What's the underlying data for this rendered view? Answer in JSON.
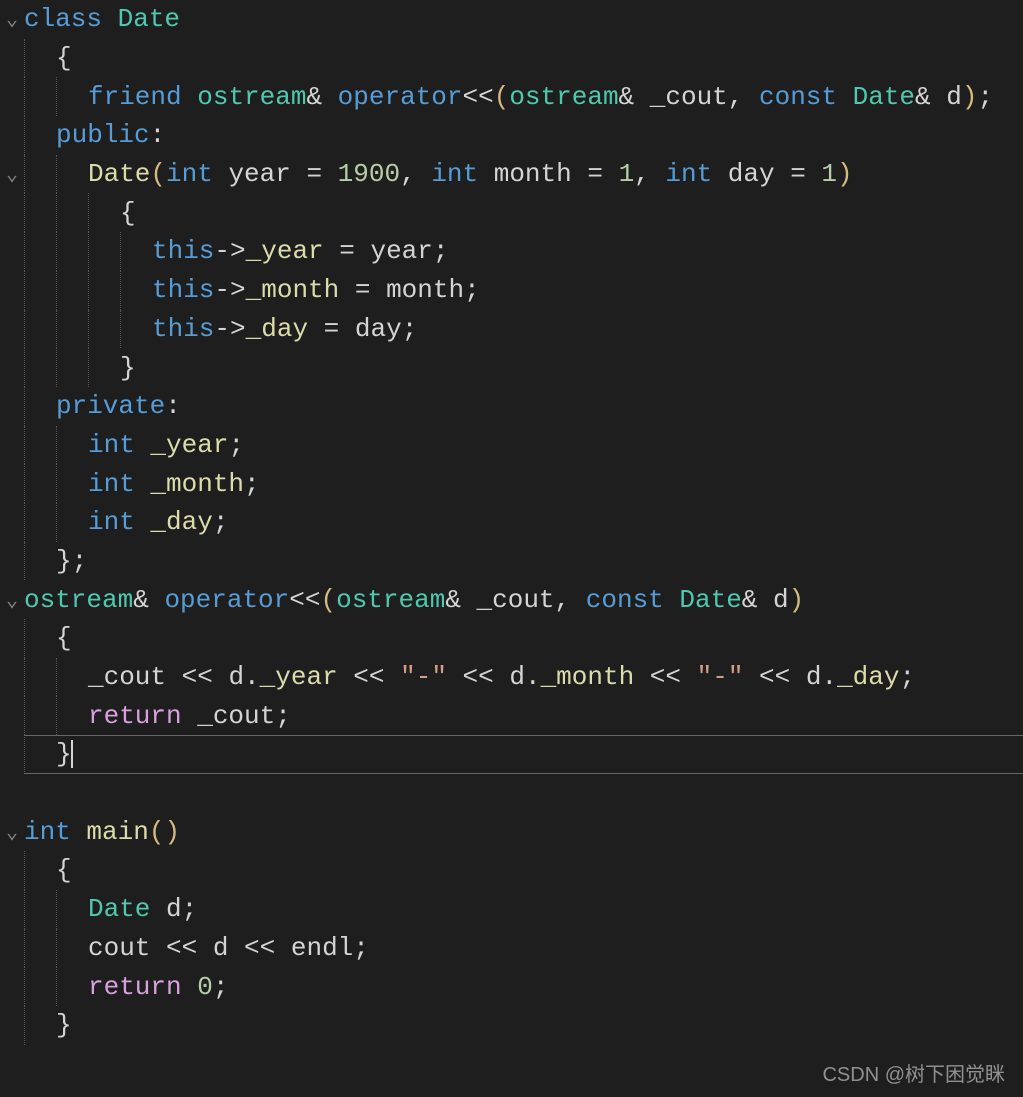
{
  "class_kw": "class",
  "class_name": "Date",
  "obrace": "{",
  "cbrace": "}",
  "cbrace_semi": "};",
  "friend_kw": "friend",
  "ostream_amp": "ostream&",
  "operator_kw": "operator",
  "shl": "<<",
  "oparen": "(",
  "cparen": ")",
  "ostream_word": "ostream",
  "amp": "&",
  "cout_param": " _cout",
  "comma_sp": ", ",
  "const_kw": "const",
  "date_type": " Date",
  "d_param": " d",
  "semi": ";",
  "public_kw": "public",
  "colon": ":",
  "int_kw": "int",
  "year_param": " year = ",
  "num_1900": "1900",
  "month_param": " month = ",
  "num_1": "1",
  "day_param": " day = ",
  "this_kw": "this",
  "arrow": "->",
  "_year": "_year",
  "eq_year": " = year",
  "_month": "_month",
  "eq_month": " = month",
  "_day": "_day",
  "eq_day": " = day",
  "private_kw": "private",
  "sp_year": " _year",
  "sp_month": " _month",
  "sp_day": " _day",
  "main_kw": "main",
  "return_kw": "return",
  "zero": " 0",
  "cout_stream": "_cout ",
  "shl_sp": " << ",
  "d_dot": "d.",
  "dash_str": "\"-\"",
  "sp_cout": " _cout",
  "Date_ctor": "Date",
  "d_var": " d",
  "cout_main": "cout ",
  "endl": "endl",
  "watermark": "CSDN @树下困觉眯"
}
